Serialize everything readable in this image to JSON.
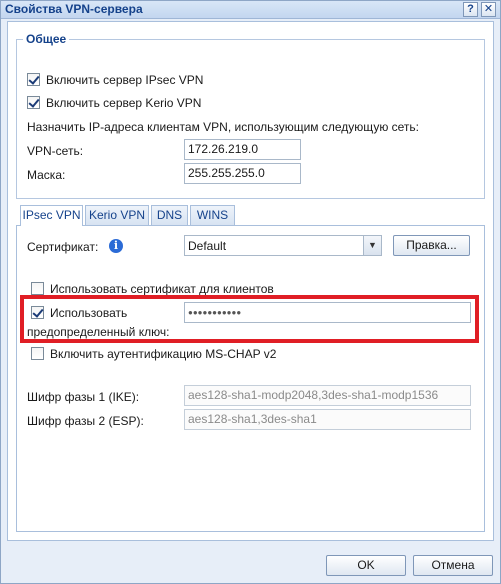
{
  "window": {
    "title": "Свойства VPN-сервера",
    "help_icon": "?",
    "close_icon": "✕"
  },
  "general": {
    "legend": "Общее",
    "enable_ipsec": {
      "label": "Включить сервер IPsec VPN",
      "checked": true
    },
    "enable_kerio": {
      "label": "Включить сервер Kerio VPN",
      "checked": true
    },
    "assign_text": "Назначить IP-адреса клиентам VPN, использующим следующую сеть:",
    "vpn_network_label": "VPN-сеть:",
    "vpn_network_value": "172.26.219.0",
    "mask_label": "Маска:",
    "mask_value": "255.255.255.0"
  },
  "tabs": [
    {
      "label": "IPsec VPN",
      "active": true
    },
    {
      "label": "Kerio VPN",
      "active": false
    },
    {
      "label": "DNS",
      "active": false
    },
    {
      "label": "WINS",
      "active": false
    }
  ],
  "ipsec": {
    "certificate_label": "Сертификат:",
    "info_icon": "i",
    "certificate_value": "Default",
    "edit_button": "Правка...",
    "use_client_cert": {
      "label": "Использовать сертификат для клиентов",
      "checked": false
    },
    "use_psk": {
      "label_line1": "Использовать",
      "label_line2": "предопределенный ключ:",
      "checked": true
    },
    "psk_value": "●●●●●●●●●●●",
    "mschap": {
      "label": "Включить аутентификацию MS-CHAP v2",
      "checked": false
    },
    "phase1_label": "Шифр фазы 1 (IKE):",
    "phase1_value": "aes128-sha1-modp2048,3des-sha1-modp1536",
    "phase2_label": "Шифр фазы 2 (ESP):",
    "phase2_value": "aes128-sha1,3des-sha1"
  },
  "footer": {
    "ok": "OK",
    "cancel": "Отмена"
  },
  "colors": {
    "accent": "#15428b",
    "highlight": "#e01e25"
  }
}
